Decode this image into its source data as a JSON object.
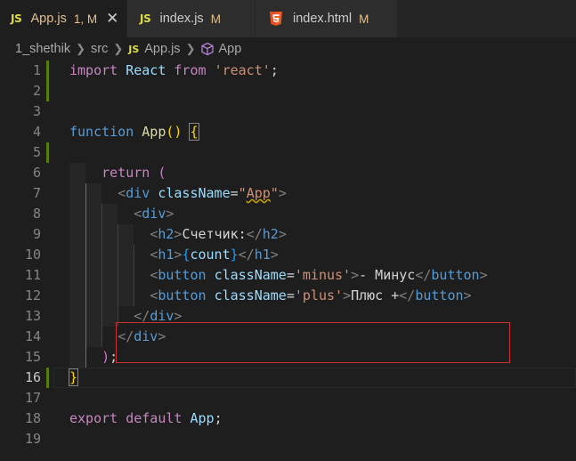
{
  "tabs": [
    {
      "icon": "js-file-icon",
      "icon_text": "JS",
      "name": "App.js",
      "flag": "1, M",
      "close": "✕",
      "active": true
    },
    {
      "icon": "js-file-icon",
      "icon_text": "JS",
      "name": "index.js",
      "flag": "M",
      "active": false
    },
    {
      "icon": "html5-file-icon",
      "name": "index.html",
      "flag": "M",
      "active": false
    }
  ],
  "breadcrumb": {
    "folder": "1_shethik",
    "sub": "src",
    "file_icon": "JS",
    "file": "App.js",
    "symbol": "App"
  },
  "colors": {
    "js_icon": "#dcdc48",
    "modified": "#e2c08d",
    "html5": "#e44d26",
    "highlight_box": "#cc3333"
  },
  "lines": [
    {
      "n": "1",
      "tokens": [
        [
          "import",
          "kw"
        ],
        [
          " ",
          "txt"
        ],
        [
          "React",
          "var"
        ],
        [
          " ",
          "txt"
        ],
        [
          "from",
          "kw"
        ],
        [
          " ",
          "txt"
        ],
        [
          "'react'",
          "str"
        ],
        [
          ";",
          "txt"
        ]
      ]
    },
    {
      "n": "2",
      "tokens": []
    },
    {
      "n": "3",
      "tokens": []
    },
    {
      "n": "4",
      "tokens": [
        [
          "function",
          "kb"
        ],
        [
          " ",
          "txt"
        ],
        [
          "App",
          "fn"
        ],
        [
          "(",
          "b1"
        ],
        [
          ")",
          "b1"
        ],
        [
          " ",
          "txt"
        ],
        [
          "{",
          "b1 bmatch"
        ]
      ]
    },
    {
      "n": "5",
      "tokens": []
    },
    {
      "n": "6",
      "tokens": [
        [
          "    ",
          "txt"
        ],
        [
          "return",
          "kw"
        ],
        [
          " ",
          "txt"
        ],
        [
          "(",
          "b2"
        ]
      ]
    },
    {
      "n": "7",
      "tokens": [
        [
          "      ",
          "txt"
        ],
        [
          "<",
          "punct"
        ],
        [
          "div",
          "tag"
        ],
        [
          " ",
          "txt"
        ],
        [
          "className",
          "attr"
        ],
        [
          "=",
          "txt"
        ],
        [
          "\"",
          "str"
        ],
        [
          "App",
          "str squig"
        ],
        [
          "\"",
          "str"
        ],
        [
          ">",
          "punct"
        ]
      ]
    },
    {
      "n": "8",
      "tokens": [
        [
          "        ",
          "txt"
        ],
        [
          "<",
          "punct"
        ],
        [
          "div",
          "tag"
        ],
        [
          ">",
          "punct"
        ]
      ]
    },
    {
      "n": "9",
      "tokens": [
        [
          "          ",
          "txt"
        ],
        [
          "<",
          "punct"
        ],
        [
          "h2",
          "tag"
        ],
        [
          ">",
          "punct"
        ],
        [
          "Счетчик:",
          "txt"
        ],
        [
          "</",
          "punct"
        ],
        [
          "h2",
          "tag"
        ],
        [
          ">",
          "punct"
        ]
      ]
    },
    {
      "n": "10",
      "tokens": [
        [
          "          ",
          "txt"
        ],
        [
          "<",
          "punct"
        ],
        [
          "h1",
          "tag"
        ],
        [
          ">",
          "punct"
        ],
        [
          "{",
          "b3"
        ],
        [
          "count",
          "var"
        ],
        [
          "}",
          "b3"
        ],
        [
          "</",
          "punct"
        ],
        [
          "h1",
          "tag"
        ],
        [
          ">",
          "punct"
        ]
      ]
    },
    {
      "n": "11",
      "tokens": [
        [
          "          ",
          "txt"
        ],
        [
          "<",
          "punct"
        ],
        [
          "button",
          "tag"
        ],
        [
          " ",
          "txt"
        ],
        [
          "className",
          "attr"
        ],
        [
          "=",
          "txt"
        ],
        [
          "'minus'",
          "str"
        ],
        [
          ">",
          "punct"
        ],
        [
          "- Минус",
          "txt"
        ],
        [
          "</",
          "punct"
        ],
        [
          "button",
          "tag"
        ],
        [
          ">",
          "punct"
        ]
      ]
    },
    {
      "n": "12",
      "tokens": [
        [
          "          ",
          "txt"
        ],
        [
          "<",
          "punct"
        ],
        [
          "button",
          "tag"
        ],
        [
          " ",
          "txt"
        ],
        [
          "className",
          "attr"
        ],
        [
          "=",
          "txt"
        ],
        [
          "'plus'",
          "str"
        ],
        [
          ">",
          "punct"
        ],
        [
          "Плюс +",
          "txt"
        ],
        [
          "</",
          "punct"
        ],
        [
          "button",
          "tag"
        ],
        [
          ">",
          "punct"
        ]
      ]
    },
    {
      "n": "13",
      "tokens": [
        [
          "        ",
          "txt"
        ],
        [
          "</",
          "punct"
        ],
        [
          "div",
          "tag"
        ],
        [
          ">",
          "punct"
        ]
      ]
    },
    {
      "n": "14",
      "tokens": [
        [
          "      ",
          "txt"
        ],
        [
          "</",
          "punct"
        ],
        [
          "div",
          "tag"
        ],
        [
          ">",
          "punct"
        ]
      ]
    },
    {
      "n": "15",
      "tokens": [
        [
          "    ",
          "txt"
        ],
        [
          ")",
          "b2"
        ],
        [
          ";",
          "txt"
        ]
      ]
    },
    {
      "n": "16",
      "tokens": [
        [
          "}",
          "b1 bmatch"
        ]
      ],
      "current": true
    },
    {
      "n": "17",
      "tokens": []
    },
    {
      "n": "18",
      "tokens": [
        [
          "export",
          "kw"
        ],
        [
          " ",
          "txt"
        ],
        [
          "default",
          "kw"
        ],
        [
          " ",
          "txt"
        ],
        [
          "App",
          "var"
        ],
        [
          ";",
          "txt"
        ]
      ]
    },
    {
      "n": "19",
      "tokens": []
    }
  ]
}
